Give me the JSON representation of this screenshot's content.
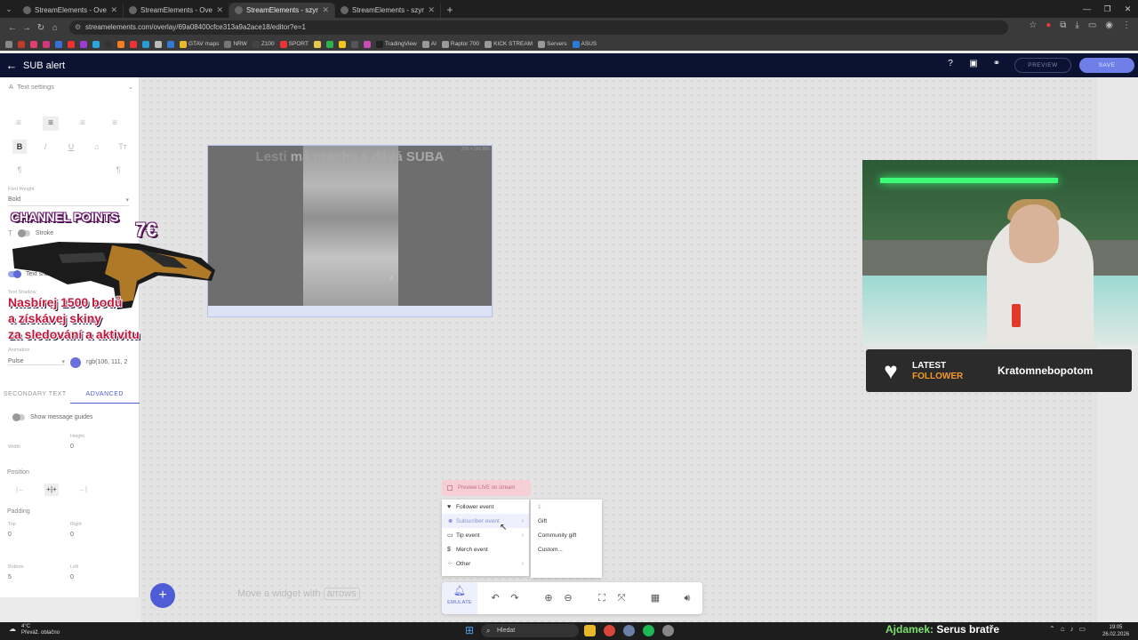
{
  "browser": {
    "tabs": [
      {
        "label": "StreamElements - Overlays",
        "active": false
      },
      {
        "label": "StreamElements - Overlays",
        "active": false
      },
      {
        "label": "StreamElements - szymonš",
        "active": true
      },
      {
        "label": "StreamElements - szymoniva",
        "active": false
      }
    ],
    "url": "streamelements.com/overlay/69a08400cfce313a9a2ace18/editor?e=1",
    "bookmarks": [
      "GTAV maps",
      "NRW",
      "Z100",
      "SPORT",
      "TradingView",
      "AI",
      "Raptor 700",
      "KICK STREAM",
      "Servers",
      "ASUS"
    ]
  },
  "editor": {
    "title": "SUB alert",
    "preview_label": "PREVIEW",
    "save_label": "SAVE"
  },
  "left_panel": {
    "section_title": "Text settings",
    "font_weight_label": "Font Weight",
    "font_weight_value": "Bold",
    "stroke_label": "Stroke",
    "text_shadow_label": "Text shadow",
    "text_shadow_sub": "Text Shadow",
    "animation_label": "Animation",
    "animation_value": "Pulse",
    "color_value": "rgb(106, 111, 2",
    "tab_secondary": "SECONDARY TEXT",
    "tab_advanced": "ADVANCED",
    "message_guides_label": "Show message guides",
    "width_label": "Width",
    "height_label": "Height",
    "height_value": "0",
    "position_label": "Position",
    "padding_label": "Padding",
    "top_label": "Top",
    "top_value": "0",
    "right_label": "Right",
    "right_value": "0",
    "bottom_label": "Bottom",
    "bottom_value": "5",
    "left_label": "Left",
    "left_value": "0"
  },
  "widget": {
    "text_a": "Lesti ",
    "text_b": "má prachy a dává SUBA",
    "corner_tag": "378 × 160 880"
  },
  "overlay_promo": {
    "title": "CHANNEL POINTS",
    "price": "7€",
    "line1": "Nasbírej 1500 bodů",
    "line2": "a získávej skiny",
    "line3": "za sledování a aktivitu"
  },
  "follower": {
    "label1": "LATEST",
    "label2": "FOLLOWER",
    "name": "Kratomnebopotom"
  },
  "emulate": {
    "preview_live": "Preview LIVE on stream",
    "events": [
      {
        "label": "Follower event",
        "icon": "heart-icon"
      },
      {
        "label": "Subscriber event",
        "icon": "user-icon"
      },
      {
        "label": "Tip event",
        "icon": "money-icon"
      },
      {
        "label": "Merch event",
        "icon": "dollar-icon"
      },
      {
        "label": "Other",
        "icon": "dots-icon"
      }
    ],
    "sub_options": [
      "1",
      "Gift",
      "Community gift",
      "Custom..."
    ],
    "emulate_label": "EMULATE"
  },
  "canvas": {
    "hint_a": "Move a widget with",
    "hint_key": "arrows"
  },
  "taskbar": {
    "weather_temp": "4°C",
    "weather_desc": "Převáž. oblačno",
    "search_placeholder": "Hledat",
    "chat_user": "Ajdamek:",
    "chat_msg": " Serus bratře",
    "time": "19:05",
    "date": "26.02.2026"
  },
  "colors": {
    "accent": "#4e5dd6",
    "header_bg": "#0c1232",
    "follower_orange": "#f39a2a"
  }
}
